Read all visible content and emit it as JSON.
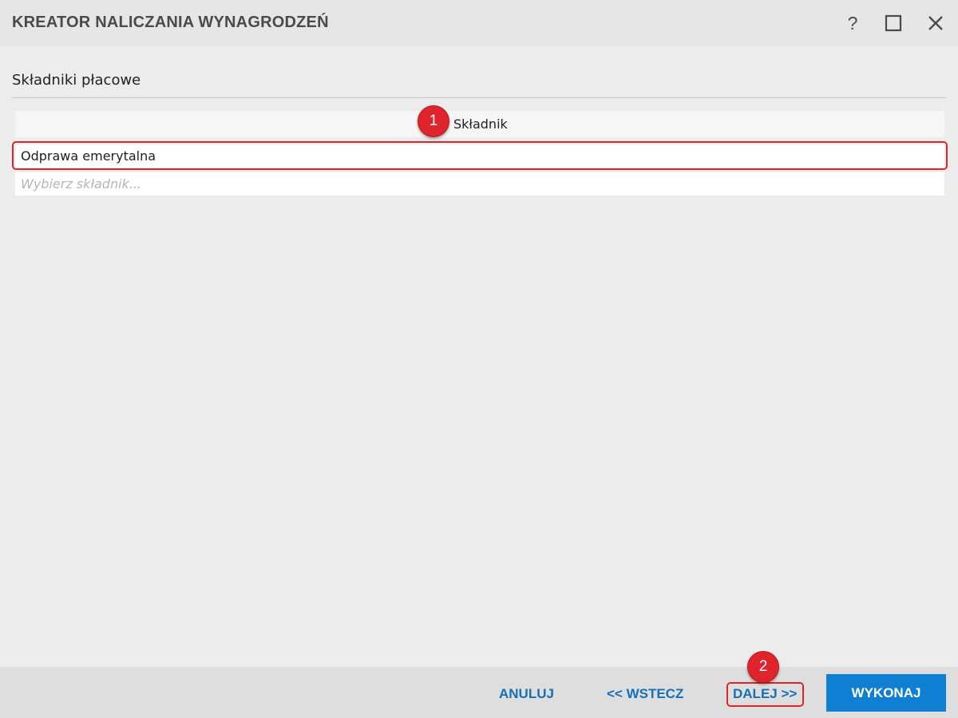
{
  "window": {
    "title": "KREATOR NALICZANIA WYNAGRODZEŃ",
    "help_label": "?"
  },
  "section": {
    "title": "Składniki płacowe"
  },
  "grid": {
    "column_header": "Składnik",
    "rows": [
      "Odprawa emerytalna"
    ],
    "new_row_placeholder": "Wybierz składnik..."
  },
  "annotations": {
    "marker_1": "1",
    "marker_2": "2",
    "color": "#e0242c"
  },
  "footer": {
    "cancel_label": "ANULUJ",
    "back_label": "<< WSTECZ",
    "next_label": "DALEJ >>",
    "execute_label": "WYKONAJ"
  },
  "colors": {
    "accent": "#0f7fd4",
    "link": "#1570b8",
    "background": "#ececec"
  }
}
